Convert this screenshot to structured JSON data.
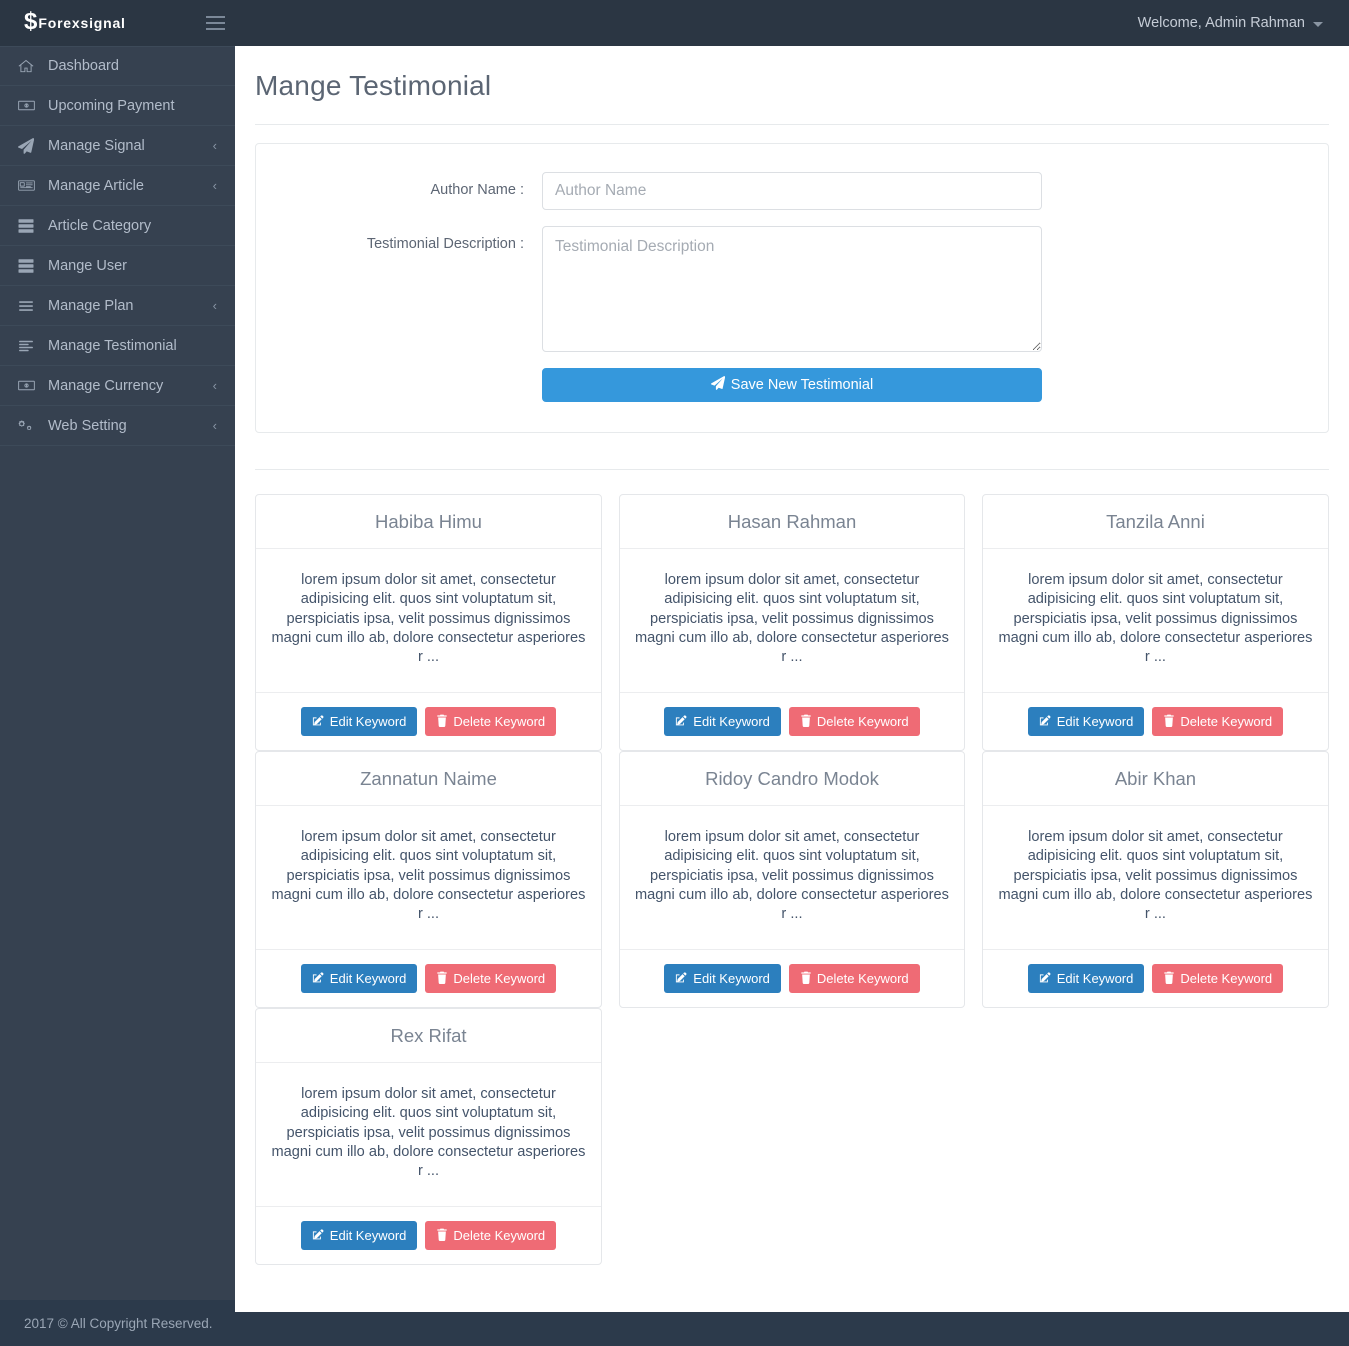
{
  "brand": {
    "dollar_glyph": "$",
    "name": "Forexsignal"
  },
  "topbar": {
    "welcome": "Welcome, Admin Rahman"
  },
  "sidebar": {
    "items": [
      {
        "label": "Dashboard",
        "icon": "home-icon",
        "chevron": ""
      },
      {
        "label": "Upcoming Payment",
        "icon": "money-bill-icon",
        "chevron": ""
      },
      {
        "label": "Manage Signal",
        "icon": "paper-plane-icon",
        "chevron": "‹"
      },
      {
        "label": "Manage Article",
        "icon": "id-card-icon",
        "chevron": "‹"
      },
      {
        "label": "Article Category",
        "icon": "server-icon",
        "chevron": ""
      },
      {
        "label": "Mange User",
        "icon": "server-icon",
        "chevron": ""
      },
      {
        "label": "Manage Plan",
        "icon": "bars-icon",
        "chevron": "‹"
      },
      {
        "label": "Manage Testimonial",
        "icon": "align-left-icon",
        "chevron": ""
      },
      {
        "label": "Manage Currency",
        "icon": "money-bill-icon",
        "chevron": "‹"
      },
      {
        "label": "Web Setting",
        "icon": "cogs-icon",
        "chevron": "‹"
      }
    ]
  },
  "footer": {
    "copyright": "2017 © All Copyright Reserved."
  },
  "page": {
    "title": "Mange Testimonial"
  },
  "form": {
    "author_label": "Author Name :",
    "author_value": "",
    "author_placeholder": "Author Name",
    "description_label": "Testimonial Description :",
    "description_value": "",
    "description_placeholder": "Testimonial Description",
    "save_label": "Save New Testimonial"
  },
  "card_actions": {
    "edit_label": "Edit Keyword",
    "delete_label": "Delete Keyword"
  },
  "colors": {
    "topbar": "#2b3643",
    "sidebar": "#364150",
    "footer": "#2c3a4b",
    "save_button": "#3598dc",
    "edit_button": "#2c7fbe",
    "delete_button": "#ef6b75",
    "body_text": "#44546a",
    "card_title": "#7a8492"
  },
  "testimonials": [
    {
      "author": "Habiba Himu",
      "text": "lorem ipsum dolor sit amet, consectetur adipisicing elit. quos sint voluptatum sit, perspiciatis ipsa, velit possimus dignissimos magni cum illo ab, dolore consectetur asperiores r ..."
    },
    {
      "author": "Hasan Rahman",
      "text": "lorem ipsum dolor sit amet, consectetur adipisicing elit. quos sint voluptatum sit, perspiciatis ipsa, velit possimus dignissimos magni cum illo ab, dolore consectetur asperiores r ..."
    },
    {
      "author": "Tanzila Anni",
      "text": "lorem ipsum dolor sit amet, consectetur adipisicing elit. quos sint voluptatum sit, perspiciatis ipsa, velit possimus dignissimos magni cum illo ab, dolore consectetur asperiores r ..."
    },
    {
      "author": "Zannatun Naime",
      "text": "lorem ipsum dolor sit amet, consectetur adipisicing elit. quos sint voluptatum sit, perspiciatis ipsa, velit possimus dignissimos magni cum illo ab, dolore consectetur asperiores r ..."
    },
    {
      "author": "Ridoy Candro Modok",
      "text": "lorem ipsum dolor sit amet, consectetur adipisicing elit. quos sint voluptatum sit, perspiciatis ipsa, velit possimus dignissimos magni cum illo ab, dolore consectetur asperiores r ..."
    },
    {
      "author": "Abir Khan",
      "text": "lorem ipsum dolor sit amet, consectetur adipisicing elit. quos sint voluptatum sit, perspiciatis ipsa, velit possimus dignissimos magni cum illo ab, dolore consectetur asperiores r ..."
    },
    {
      "author": "Rex Rifat",
      "text": "lorem ipsum dolor sit amet, consectetur adipisicing elit. quos sint voluptatum sit, perspiciatis ipsa, velit possimus dignissimos magni cum illo ab, dolore consectetur asperiores r ..."
    }
  ]
}
